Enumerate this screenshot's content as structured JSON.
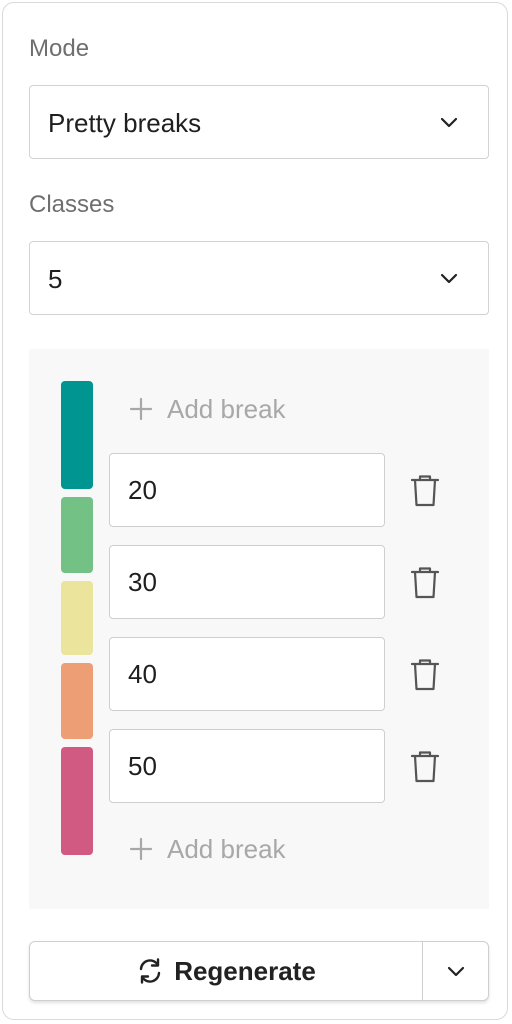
{
  "mode": {
    "label": "Mode",
    "selected": "Pretty breaks"
  },
  "classes": {
    "label": "Classes",
    "selected": "5"
  },
  "swatch_colors": [
    "#009591",
    "#73c185",
    "#eae49d",
    "#ed9e75",
    "#d05a81"
  ],
  "add_break_label": "Add break",
  "breaks": [
    {
      "value": "20"
    },
    {
      "value": "30"
    },
    {
      "value": "40"
    },
    {
      "value": "50"
    }
  ],
  "icons": {
    "chevron": "chevron-down-icon",
    "plus": "plus-icon",
    "trash": "trash-icon",
    "refresh": "refresh-icon"
  },
  "regenerate": {
    "label": "Regenerate"
  }
}
